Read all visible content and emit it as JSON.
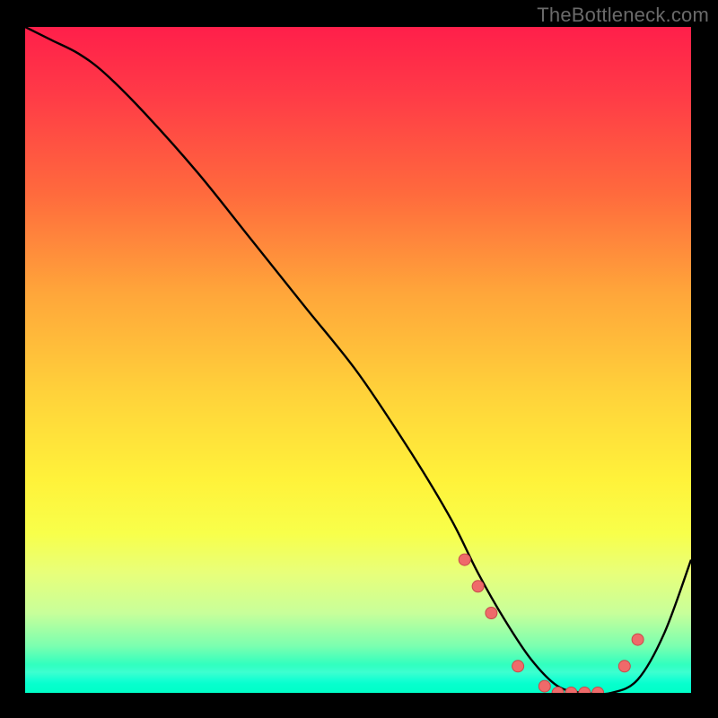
{
  "watermark": "TheBottleneck.com",
  "colors": {
    "page_bg": "#000000",
    "text_muted": "#6a6a6a",
    "curve": "#000000",
    "marker_fill": "#ef6a6a",
    "marker_stroke": "#c74b4b"
  },
  "chart_data": {
    "type": "line",
    "title": "",
    "xlabel": "",
    "ylabel": "",
    "xlim": [
      0,
      100
    ],
    "ylim": [
      0,
      100
    ],
    "grid": false,
    "legend": false,
    "series": [
      {
        "name": "bottleneck-curve",
        "x": [
          0,
          4,
          8,
          12,
          18,
          26,
          34,
          42,
          50,
          58,
          64,
          68,
          72,
          76,
          80,
          84,
          88,
          92,
          96,
          100
        ],
        "y": [
          100,
          98,
          96,
          93,
          87,
          78,
          68,
          58,
          48,
          36,
          26,
          18,
          11,
          5,
          1,
          0,
          0,
          2,
          9,
          20
        ]
      }
    ],
    "markers": {
      "name": "highlighted-points",
      "x": [
        66,
        68,
        70,
        74,
        78,
        80,
        82,
        84,
        86,
        90,
        92
      ],
      "y": [
        20,
        16,
        12,
        4,
        1,
        0,
        0,
        0,
        0,
        4,
        8
      ]
    }
  }
}
